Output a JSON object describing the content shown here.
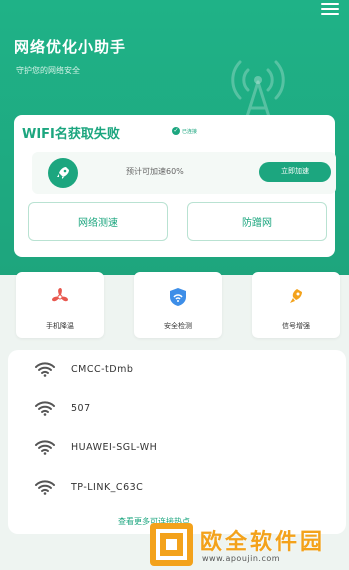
{
  "header": {
    "title": "网络优化小助手",
    "subtitle": "守护您的网络安全"
  },
  "main_card": {
    "wifi_status": "WIFI名获取失败",
    "status_chip": "已连接",
    "accel_text": "预计可加速60%",
    "accel_button": "立即加速",
    "actions": [
      "网络测速",
      "防蹭网"
    ]
  },
  "tools": [
    {
      "label": "手机降温",
      "icon": "fan-icon"
    },
    {
      "label": "安全检测",
      "icon": "shield-icon"
    },
    {
      "label": "信号增强",
      "icon": "signal-icon"
    }
  ],
  "wifi_list": [
    "CMCC-tDmb",
    "507",
    "HUAWEI-SGL-WH",
    "TP-LINK_C63C"
  ],
  "more_link": "查看更多可连接热点",
  "watermark": {
    "title": "欧全软件园",
    "url": "www.apoujin.com"
  },
  "colors": {
    "primary": "#1ca67f",
    "accent_orange": "#f3a21b",
    "fan_red": "#e8584f",
    "shield_blue": "#3d8ee8"
  }
}
